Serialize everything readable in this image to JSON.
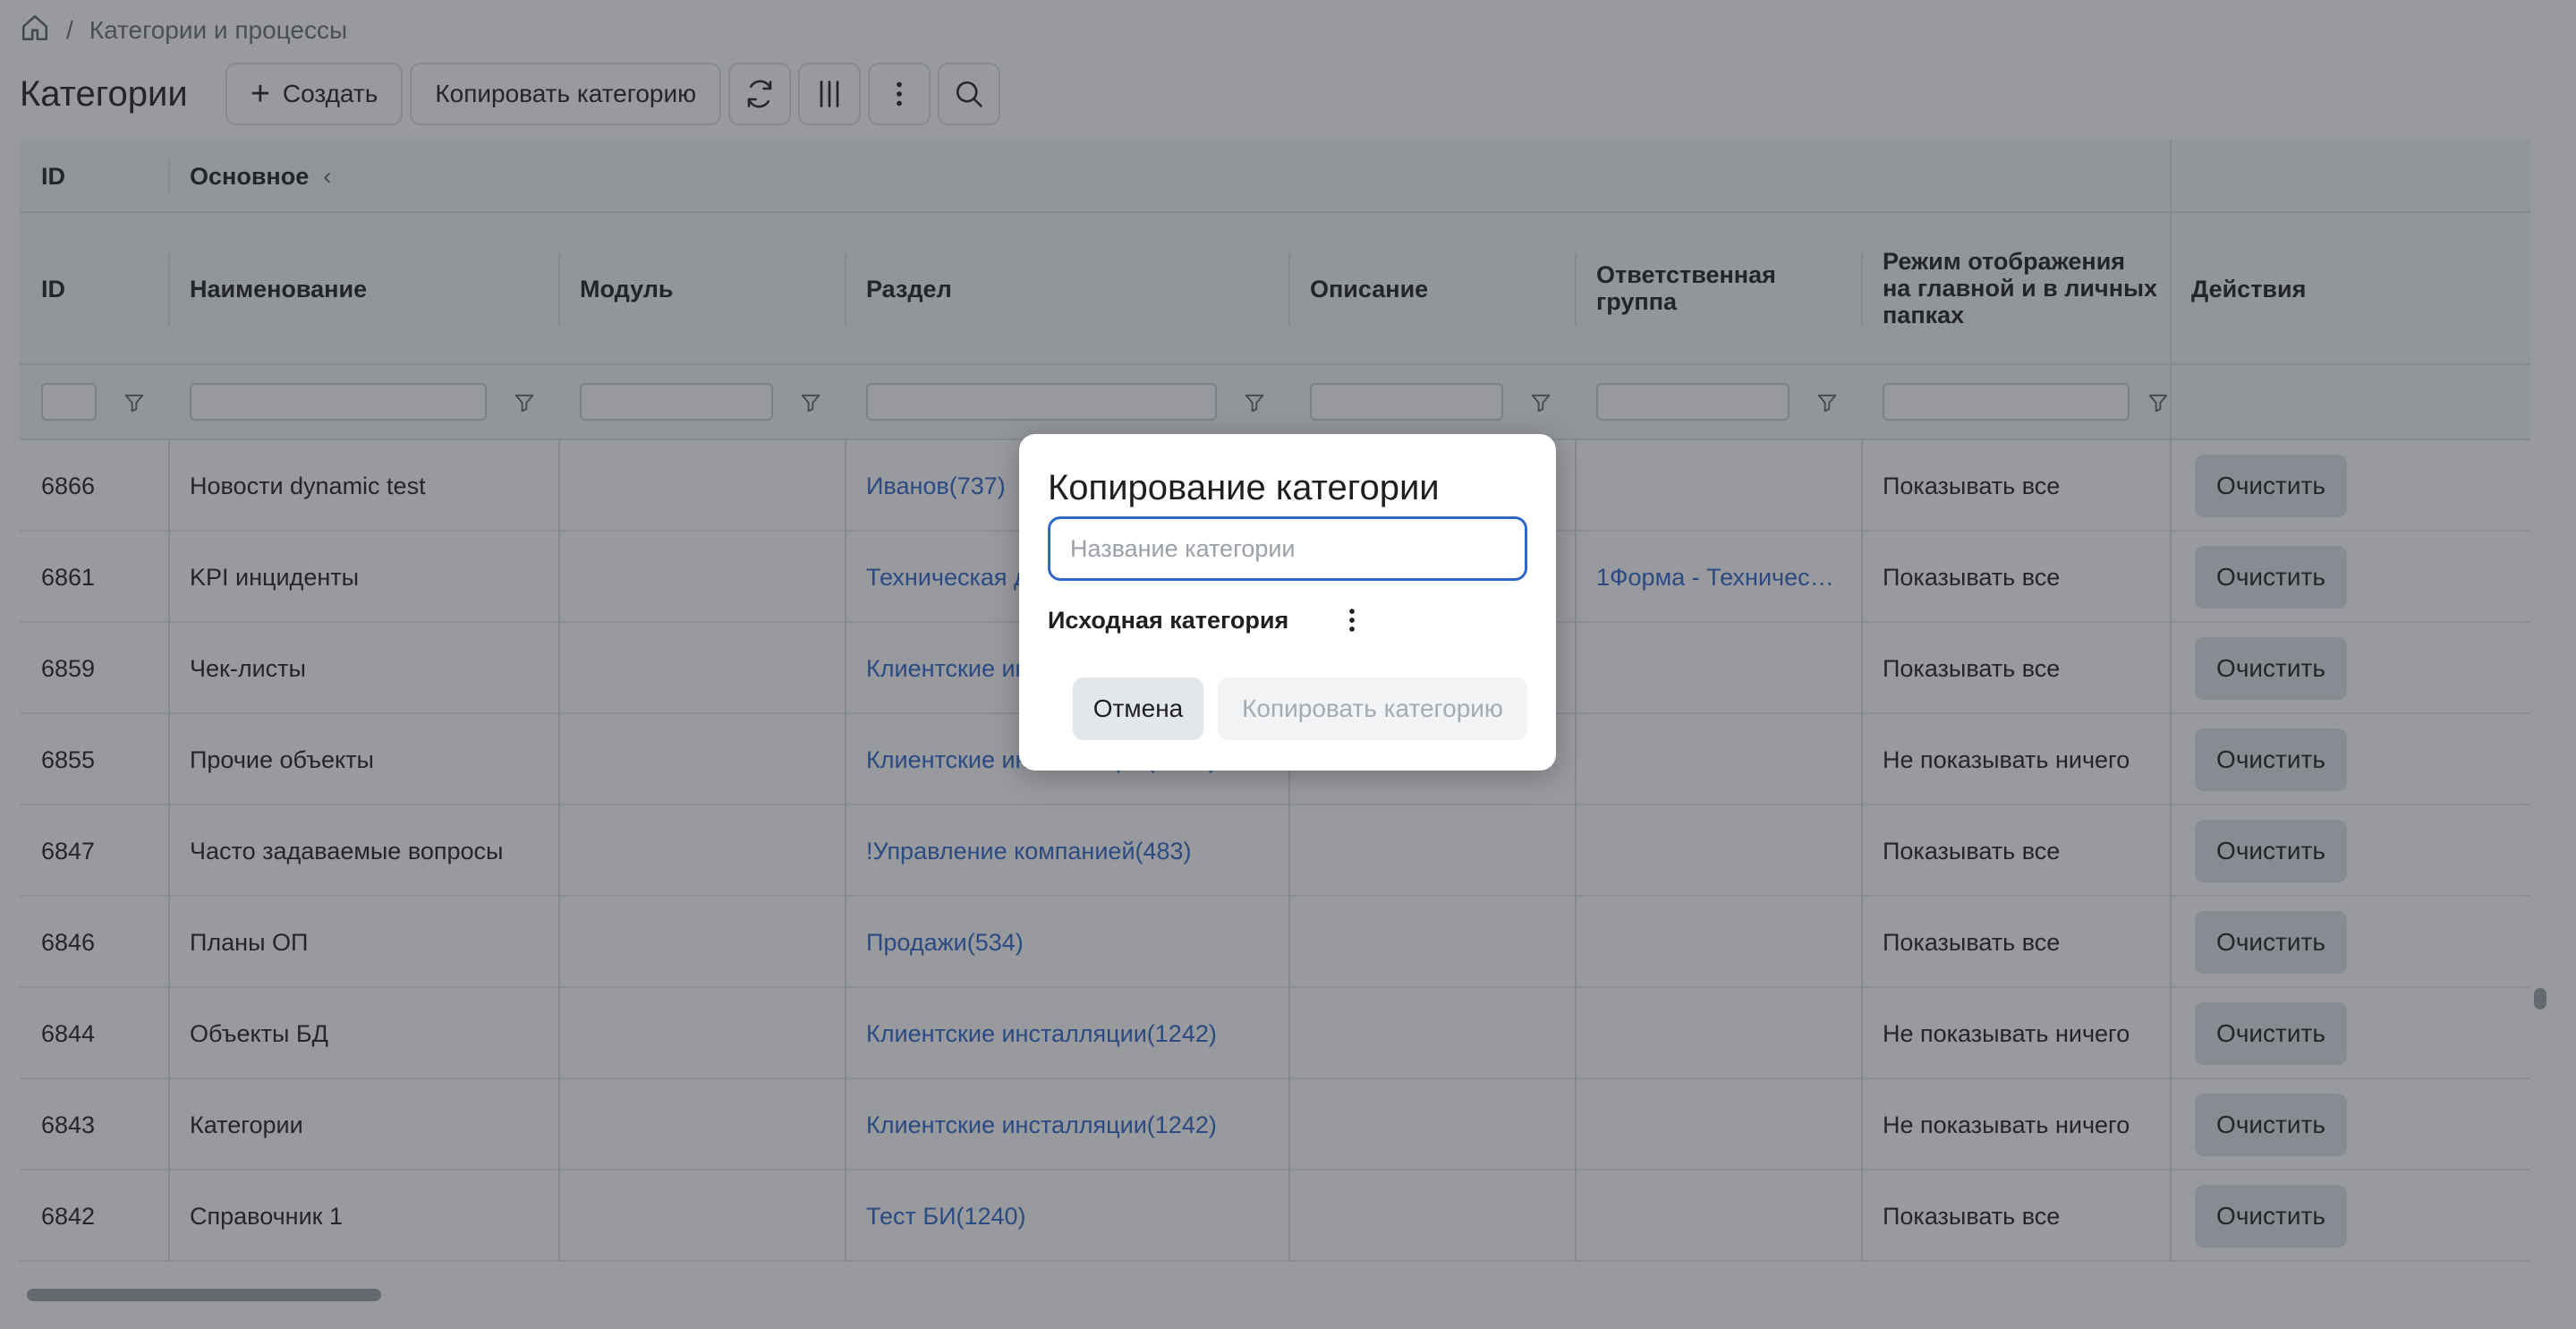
{
  "breadcrumb": {
    "separator": "/",
    "current": "Категории и процессы"
  },
  "toolbar": {
    "title": "Категории",
    "create_label": "Создать",
    "copy_label": "Копировать категорию"
  },
  "table": {
    "group_headers": {
      "id": "ID",
      "main": "Основное",
      "main_collapse": "‹"
    },
    "columns": {
      "id": "ID",
      "name": "Наименование",
      "module": "Модуль",
      "section": "Раздел",
      "description": "Описание",
      "group": "Ответственная группа",
      "mode": "Режим отображения на главной и в личных папках",
      "actions": "Действия"
    },
    "rows": [
      {
        "id": "6866",
        "name": "Новости dynamic test",
        "section": "Иванов(737)",
        "group": "",
        "mode": "Показывать все",
        "action": "Очистить"
      },
      {
        "id": "6861",
        "name": "KPI инциденты",
        "section": "Техническая документация(1238)",
        "group": "1Форма - Техничес…",
        "mode": "Показывать все",
        "action": "Очистить"
      },
      {
        "id": "6859",
        "name": "Чек-листы",
        "section": "Клиентские инсталляции(1242)",
        "group": "",
        "mode": "Показывать все",
        "action": "Очистить"
      },
      {
        "id": "6855",
        "name": "Прочие объекты",
        "section": "Клиентские инсталляции(1242)",
        "group": "",
        "mode": "Не показывать ничего",
        "action": "Очистить"
      },
      {
        "id": "6847",
        "name": "Часто задаваемые вопросы",
        "section": "!Управление компанией(483)",
        "group": "",
        "mode": "Показывать все",
        "action": "Очистить"
      },
      {
        "id": "6846",
        "name": "Планы ОП",
        "section": "Продажи(534)",
        "group": "",
        "mode": "Показывать все",
        "action": "Очистить"
      },
      {
        "id": "6844",
        "name": "Объекты БД",
        "section": "Клиентские инсталляции(1242)",
        "group": "",
        "mode": "Не показывать ничего",
        "action": "Очистить"
      },
      {
        "id": "6843",
        "name": "Категории",
        "section": "Клиентские инсталляции(1242)",
        "group": "",
        "mode": "Не показывать ничего",
        "action": "Очистить"
      },
      {
        "id": "6842",
        "name": "Справочник 1",
        "section": "Тест БИ(1240)",
        "group": "",
        "mode": "Показывать все",
        "action": "Очистить"
      }
    ]
  },
  "modal": {
    "title": "Копирование категории",
    "input_placeholder": "Название категории",
    "input_value": "",
    "source_label": "Исходная категория",
    "cancel_label": "Отмена",
    "copy_label": "Копировать категорию"
  },
  "colors": {
    "accent": "#2f67c9",
    "link": "#2f67c9",
    "header_bg": "#f4f5f7",
    "overlay": "rgba(40,44,52,0.48)"
  },
  "icons": [
    "home-icon",
    "plus-icon",
    "refresh-icon",
    "columns-icon",
    "more-vertical-icon",
    "search-icon",
    "filter-icon",
    "chevron-left-icon"
  ]
}
